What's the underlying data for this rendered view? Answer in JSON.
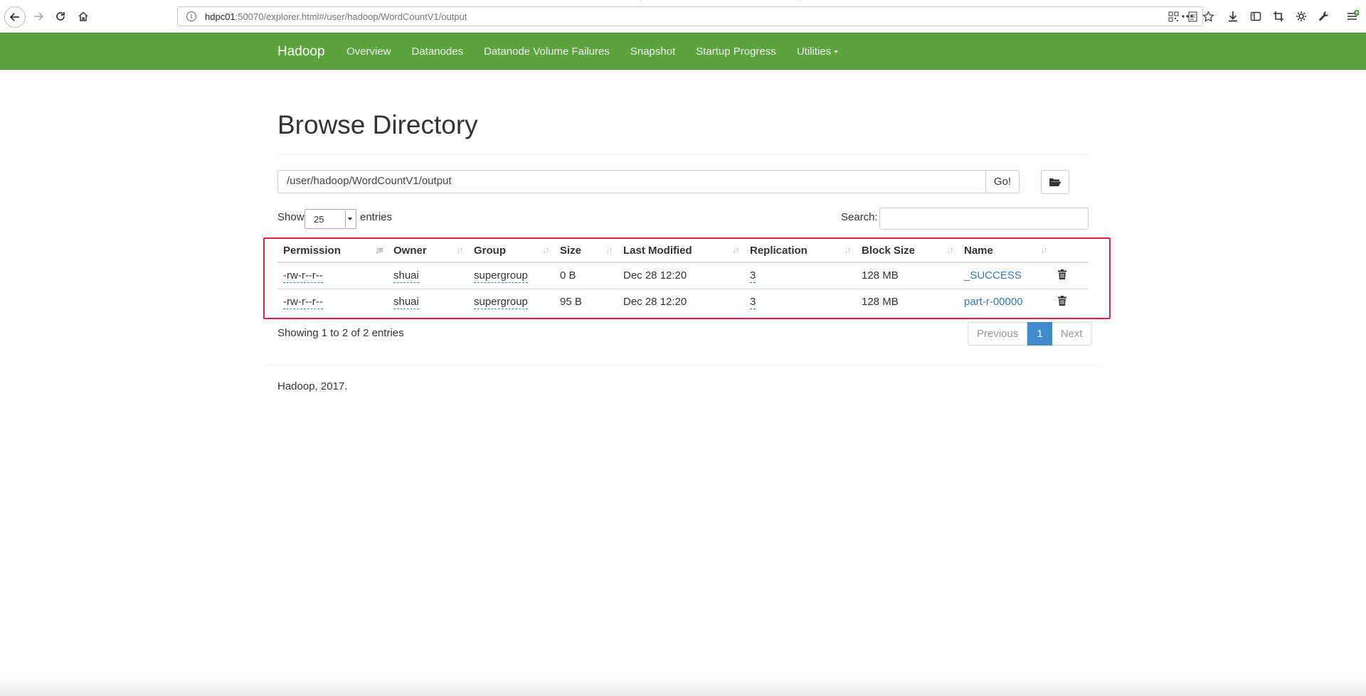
{
  "browser": {
    "url_host": "hdpc01",
    "url_rest": ":50070/explorer.html#/user/hadoop/WordCountV1/output",
    "url_info": "i"
  },
  "navbar": {
    "brand": "Hadoop",
    "items": [
      "Overview",
      "Datanodes",
      "Datanode Volume Failures",
      "Snapshot",
      "Startup Progress",
      "Utilities"
    ],
    "color": "#5ba43d"
  },
  "page": {
    "title": "Browse Directory",
    "directory_value": "/user/hadoop/WordCountV1/output",
    "go_label": "Go!",
    "show_label": "Show",
    "page_length": "25",
    "entries_label": "entries",
    "search_label": "Search:",
    "search_value": ""
  },
  "table": {
    "columns": [
      "Permission",
      "Owner",
      "Group",
      "Size",
      "Last Modified",
      "Replication",
      "Block Size",
      "Name"
    ],
    "rows": [
      {
        "permission": "-rw-r--r--",
        "owner": "shuai",
        "group": "supergroup",
        "size": "0 B",
        "last_modified": "Dec 28 12:20",
        "replication": "3",
        "block_size": "128 MB",
        "name": "_SUCCESS"
      },
      {
        "permission": "-rw-r--r--",
        "owner": "shuai",
        "group": "supergroup",
        "size": "95 B",
        "last_modified": "Dec 28 12:20",
        "replication": "3",
        "block_size": "128 MB",
        "name": "part-r-00000"
      }
    ],
    "highlight_color": "#e0243f"
  },
  "pagination": {
    "info": "Showing 1 to 2 of 2 entries",
    "previous": "Previous",
    "current": "1",
    "next": "Next"
  },
  "footer": {
    "text": "Hadoop, 2017."
  }
}
